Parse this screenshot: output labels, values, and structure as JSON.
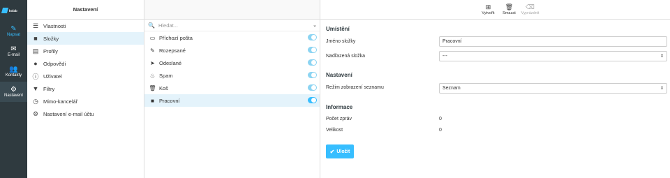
{
  "app": {
    "logo_text": "kolab"
  },
  "nav": [
    {
      "label": "Napsat",
      "icon": "compose-icon"
    },
    {
      "label": "E-mail",
      "icon": "envelope-icon"
    },
    {
      "label": "Kontakty",
      "icon": "contacts-icon"
    },
    {
      "label": "Nastavení",
      "icon": "gear-icon"
    }
  ],
  "settings": {
    "title": "Nastavení",
    "items": [
      {
        "label": "Vlastnosti",
        "icon": "sliders-icon"
      },
      {
        "label": "Složky",
        "icon": "folder-icon"
      },
      {
        "label": "Profily",
        "icon": "id-card-icon"
      },
      {
        "label": "Odpovědi",
        "icon": "comment-icon"
      },
      {
        "label": "Uživatel",
        "icon": "info-icon"
      },
      {
        "label": "Filtry",
        "icon": "filter-icon"
      },
      {
        "label": "Mimo-kancelář",
        "icon": "clock-icon"
      },
      {
        "label": "Nastavení e-mail účtu",
        "icon": "cog-icon"
      }
    ]
  },
  "folders": {
    "search_placeholder": "Hledat...",
    "items": [
      {
        "label": "Příchozí pošta",
        "icon": "inbox-icon"
      },
      {
        "label": "Rozepsané",
        "icon": "pencil-icon"
      },
      {
        "label": "Odeslané",
        "icon": "paper-plane-icon"
      },
      {
        "label": "Spam",
        "icon": "fire-icon"
      },
      {
        "label": "Koš",
        "icon": "trash-icon"
      },
      {
        "label": "Pracovní",
        "icon": "folder-icon"
      }
    ]
  },
  "toolbar": {
    "create": "Vytvořit",
    "delete": "Smazat",
    "empty": "Vyprázdnit"
  },
  "detail": {
    "location_title": "Umístění",
    "folder_name_label": "Jméno složky",
    "folder_name_value": "Pracovní",
    "parent_label": "Nadřazená složka",
    "parent_value": "---",
    "settings_title": "Nastavení",
    "list_mode_label": "Režim zobrazení seznamu",
    "list_mode_value": "Seznam",
    "info_title": "Informace",
    "count_label": "Počet zpráv",
    "count_value": "0",
    "size_label": "Velikost",
    "size_value": "0",
    "save_label": "Uložit"
  },
  "colors": {
    "accent": "#37beff",
    "rail": "#2f3a3f"
  }
}
